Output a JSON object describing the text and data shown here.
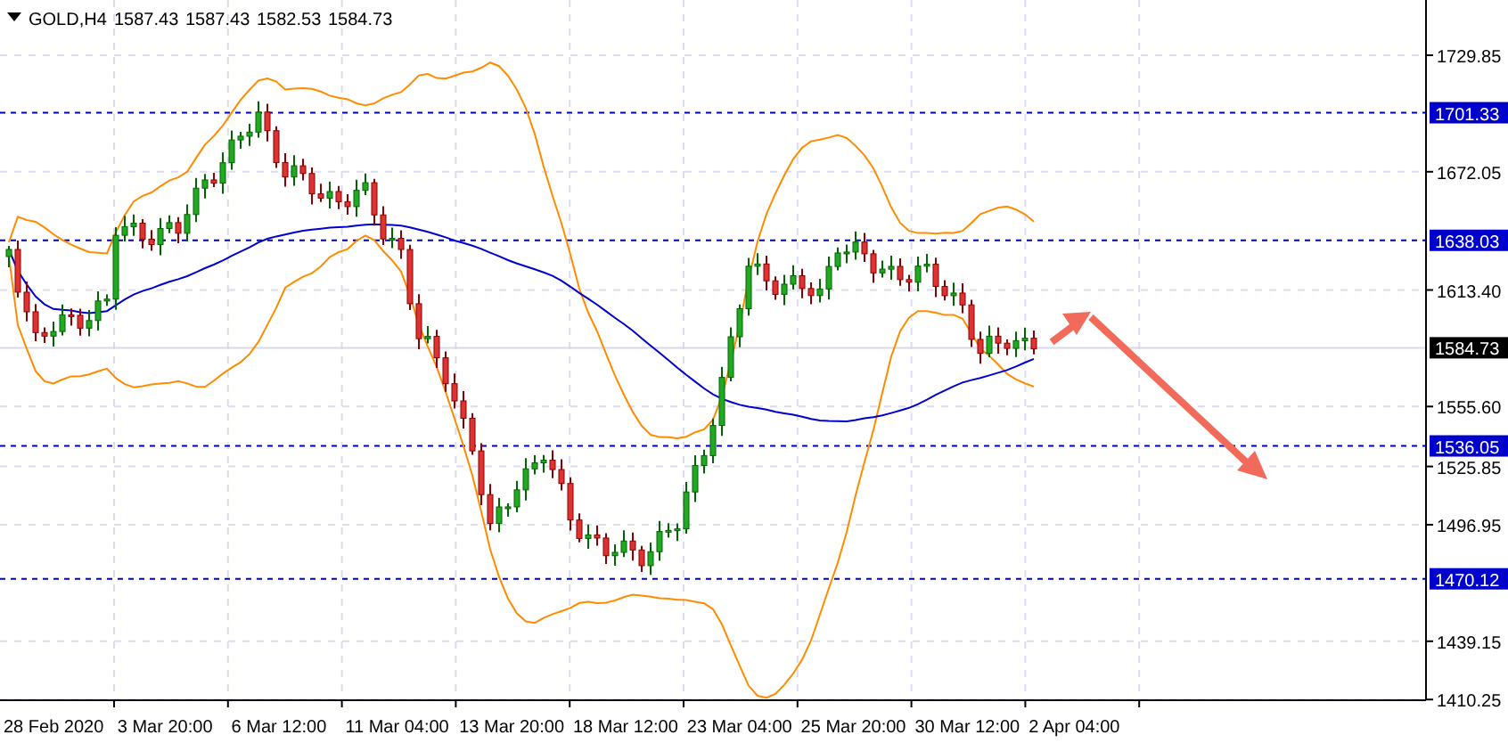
{
  "header": {
    "symbol": "GOLD,H4",
    "quote_values": [
      "1587.43",
      "1587.43",
      "1582.53",
      "1584.73"
    ]
  },
  "price_axis": {
    "ticks": [
      "1729.85",
      "1672.05",
      "1613.40",
      "1555.60",
      "1525.85",
      "1496.95",
      "1439.15",
      "1410.25"
    ]
  },
  "levels": [
    {
      "price": "1701.33"
    },
    {
      "price": "1638.03"
    },
    {
      "price": "1536.05"
    },
    {
      "price": "1470.12"
    }
  ],
  "current_price": "1584.73",
  "time_axis": {
    "labels": [
      "28 Feb 2020",
      "3 Mar 20:00",
      "6 Mar 12:00",
      "11 Mar 04:00",
      "13 Mar 20:00",
      "18 Mar 12:00",
      "23 Mar 04:00",
      "25 Mar 20:00",
      "30 Mar 12:00",
      "2 Apr 04:00"
    ]
  }
}
